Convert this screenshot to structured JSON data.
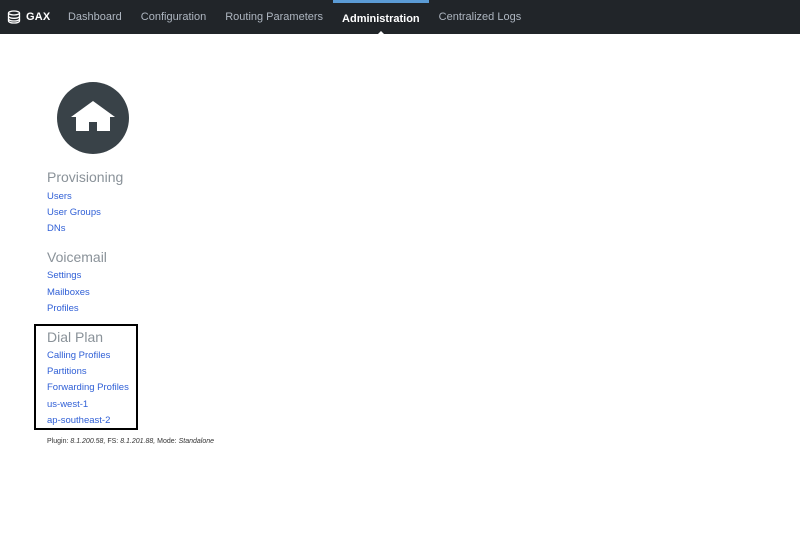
{
  "header": {
    "brand": "GAX",
    "tabs": [
      {
        "label": "Dashboard"
      },
      {
        "label": "Configuration"
      },
      {
        "label": "Routing Parameters"
      },
      {
        "label": "Administration"
      },
      {
        "label": "Centralized Logs"
      }
    ],
    "active_tab": "Administration"
  },
  "sections": {
    "provisioning": {
      "title": "Provisioning",
      "links": [
        "Users",
        "User Groups",
        "DNs"
      ]
    },
    "voicemail": {
      "title": "Voicemail",
      "links": [
        "Settings",
        "Mailboxes",
        "Profiles"
      ]
    },
    "dial_plan": {
      "title": "Dial Plan",
      "links": [
        "Calling Profiles",
        "Partitions",
        "Forwarding Profiles",
        "us-west-1",
        "ap-southeast-2"
      ]
    }
  },
  "footer": {
    "plugin_label": "Plugin:",
    "plugin_version": "8.1.200.58,",
    "fs_label": "FS:",
    "fs_version": "8.1.201.88,",
    "mode_label": "Mode:",
    "mode_value": "Standalone"
  },
  "colors": {
    "topbar": "#212529",
    "link": "#2f5fd6",
    "section_title": "#8a9299",
    "home_circle": "#394248",
    "active_indicator": "#5b9bd5"
  },
  "icons": {
    "brand": "database-icon",
    "home": "home-icon"
  }
}
